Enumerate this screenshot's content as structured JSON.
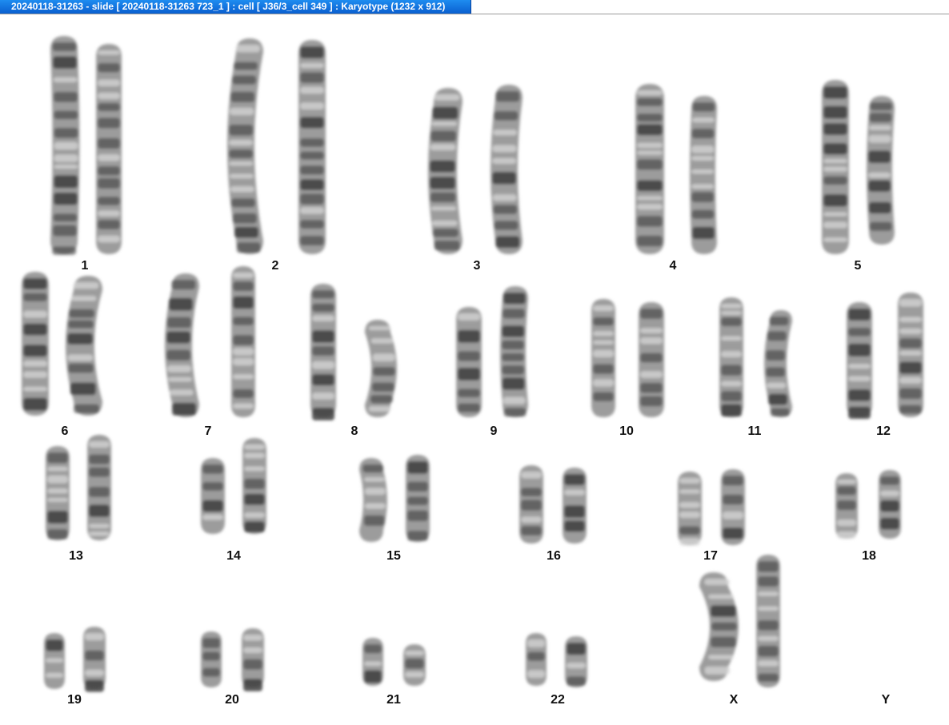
{
  "window": {
    "title": "20240118-31263 - slide [ 20240118-31263 723_1 ] : cell [ J36/3_cell 349 ] : Karyotype  (1232 x 912)"
  },
  "karyotype": {
    "labels": [
      "1",
      "2",
      "3",
      "4",
      "5",
      "6",
      "7",
      "8",
      "9",
      "10",
      "11",
      "12",
      "13",
      "14",
      "15",
      "16",
      "17",
      "18",
      "19",
      "20",
      "21",
      "22",
      "X",
      "Y"
    ]
  },
  "colors": {
    "chromatid_fill": "#9c9c9c",
    "dark_band": "#3e3e3e",
    "light_band": "#dcdcdc",
    "title_bar": "#1476e0"
  }
}
